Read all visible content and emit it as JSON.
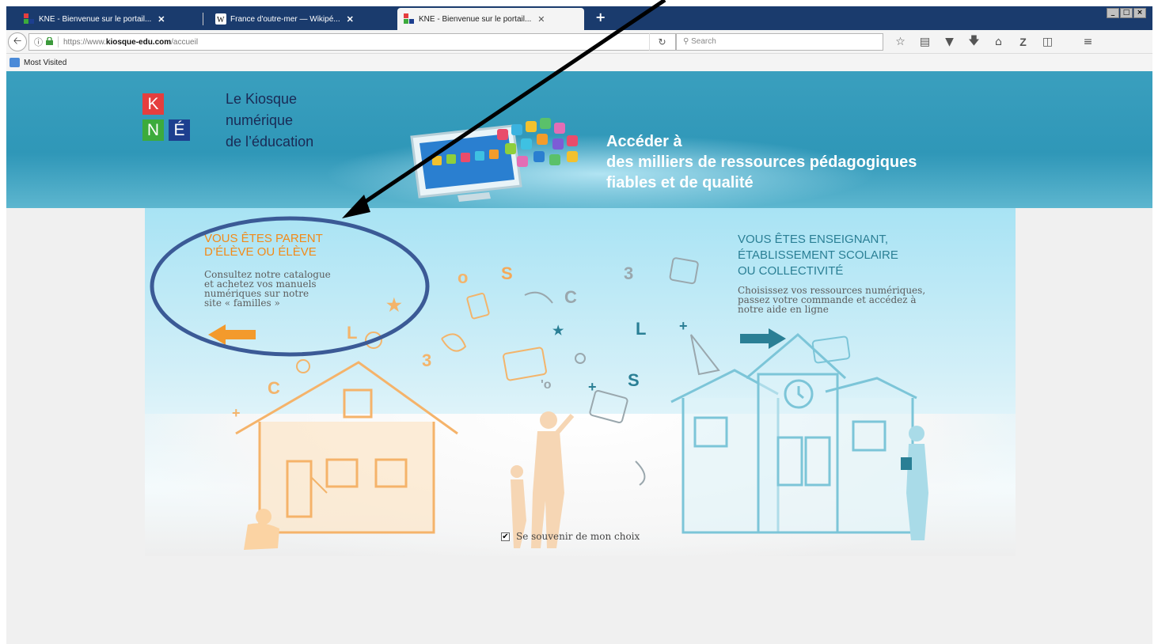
{
  "browser": {
    "tabs": [
      {
        "title": "KNE - Bienvenue sur le portail...",
        "close": "✕",
        "active": false
      },
      {
        "title": "France d'outre-mer — Wikipé...",
        "close": "✕",
        "active": false
      },
      {
        "title": "KNE - Bienvenue sur le portail...",
        "close": "✕",
        "active": true
      }
    ],
    "new_tab": "+",
    "address": {
      "prefix": "https://www.",
      "host": "kiosque-edu.com",
      "path": "/accueil"
    },
    "search_placeholder": "Search",
    "bookmarks": [
      {
        "label": "Most Visited"
      }
    ],
    "toolbar_icons": [
      "star-icon",
      "reading-list-icon",
      "pocket-icon",
      "download-icon",
      "home-icon",
      "zotero-icon",
      "sidebar-icon",
      "menu-icon"
    ]
  },
  "site": {
    "logo_letters": [
      "K",
      "N",
      "É"
    ],
    "logo_text": [
      "Le Kiosque",
      "numérique",
      "de l’éducation"
    ],
    "tagline": [
      "Accéder à",
      "des milliers de ressources pédagogiques",
      "fiables et de qualité"
    ]
  },
  "chooser": {
    "parent": {
      "title": [
        "VOUS ÊTES PARENT",
        "D’ÉLÈVE OU ÉLÈVE"
      ],
      "desc": [
        "Consultez notre catalogue",
        "et achetez vos manuels",
        "numériques sur notre",
        "site « familles »"
      ]
    },
    "teacher": {
      "title": [
        "VOUS ÊTES ENSEIGNANT,",
        "ÉTABLISSEMENT SCOLAIRE",
        "OU COLLECTIVITÉ"
      ],
      "desc": [
        "Choisissez vos ressources numériques,",
        "passez votre commande et accédez à",
        "notre aide en ligne"
      ]
    },
    "remember_label": "Se souvenir de mon choix",
    "remember_checked": true
  },
  "colors": {
    "parent_accent": "#f28a18",
    "teacher_accent": "#2a7f95",
    "banner": "#2f97b8",
    "tabstrip": "#1a3b6d"
  }
}
